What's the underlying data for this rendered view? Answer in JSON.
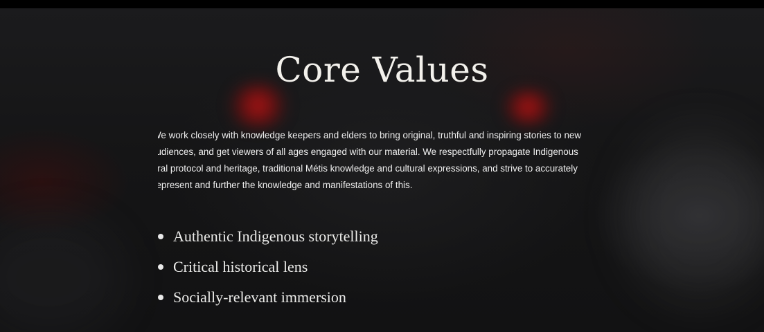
{
  "slide": {
    "title": "Core Values",
    "paragraph_lines": [
      "We work closely with knowledge keepers and elders to bring original, truthful and inspiring stories to new",
      "audiences, and get viewers of all ages engaged with our material. We respectfully propagate Indigenous",
      "cultural protocol and heritage, traditional Métis knowledge and cultural expressions, and strive to accurately",
      "represent and further the knowledge and manifestations of this."
    ],
    "values": [
      "Authentic Indigenous storytelling",
      "Critical historical lens",
      "Socially-relevant immersion"
    ]
  },
  "colors": {
    "background": "#151516",
    "text": "#f3f1ec",
    "accent_glow": "#d21414"
  }
}
